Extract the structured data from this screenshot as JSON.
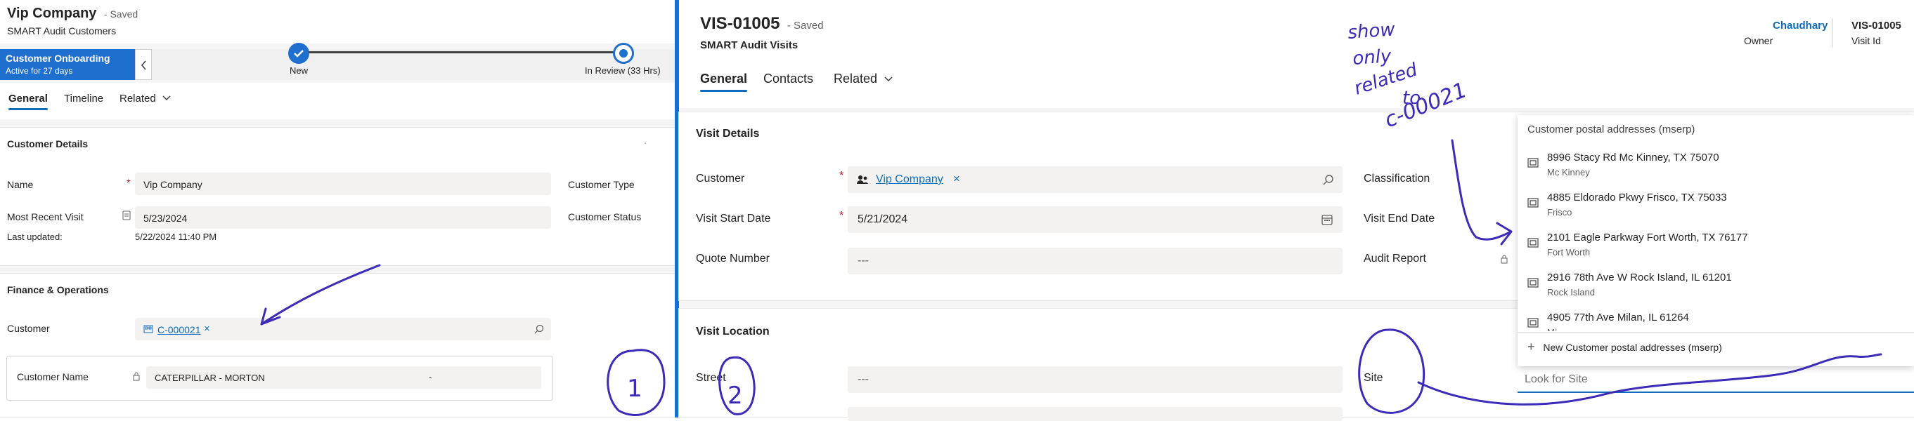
{
  "left": {
    "title": "Vip Company",
    "saved": "- Saved",
    "subtitle": "SMART Audit Customers",
    "bpf": {
      "stage_name": "Customer Onboarding",
      "stage_sub": "Active for 27 days",
      "step1": "New",
      "step2": "In Review",
      "step2_time": "(33 Hrs)"
    },
    "tabs": [
      "General",
      "Timeline",
      "Related"
    ],
    "customer_details": {
      "header": "Customer Details",
      "name_label": "Name",
      "name_value": "Vip Company",
      "customer_type_label": "Customer Type",
      "most_recent_visit_label": "Most Recent Visit",
      "most_recent_visit_value": "5/23/2024",
      "customer_status_label": "Customer Status",
      "last_updated_label": "Last updated:",
      "last_updated_value": "5/22/2024 11:40 PM"
    },
    "finance": {
      "header": "Finance & Operations",
      "customer_label": "Customer",
      "customer_value": "C-000021",
      "customer_name_label": "Customer Name",
      "customer_name_value": "CATERPILLAR - MORTON",
      "customer_name_suffix": "-"
    }
  },
  "right": {
    "title": "VIS-01005",
    "saved": "- Saved",
    "subtitle": "SMART Audit Visits",
    "owner_name": "Chaudhary",
    "owner_label": "Owner",
    "visit_id_value": "VIS-01005",
    "visit_id_label": "Visit Id",
    "tabs": [
      "General",
      "Contacts",
      "Related"
    ],
    "visit_details": {
      "header": "Visit Details",
      "customer_label": "Customer",
      "customer_value": "Vip Company",
      "classification_label": "Classification",
      "visit_start_label": "Visit Start Date",
      "visit_start_value": "5/21/2024",
      "visit_end_label": "Visit End Date",
      "quote_number_label": "Quote Number",
      "quote_number_value": "---",
      "audit_report_label": "Audit Report"
    },
    "visit_location": {
      "header": "Visit Location",
      "street_label": "Street",
      "street_value": "---",
      "site_label": "Site",
      "site_placeholder": "Look for Site"
    },
    "dropdown": {
      "header": "Customer postal addresses (mserp)",
      "items": [
        {
          "address": "8996 Stacy Rd Mc Kinney, TX 75070",
          "city": "Mc Kinney"
        },
        {
          "address": "4885 Eldorado Pkwy Frisco, TX 75033",
          "city": "Frisco"
        },
        {
          "address": "2101 Eagle Parkway Fort Worth, TX 76177",
          "city": "Fort Worth"
        },
        {
          "address": "2916 78th Ave W Rock Island, IL 61201",
          "city": "Rock Island"
        },
        {
          "address": "4905 77th Ave Milan, IL 61264",
          "city": "Mi"
        }
      ],
      "new_label": "New Customer postal addresses (mserp)"
    }
  },
  "annotations": {
    "note_lines": [
      "show",
      "only",
      "related",
      "to",
      "c-00021"
    ],
    "circle_1": "1",
    "circle_2": "2"
  },
  "colors": {
    "accent": "#0f6cbd",
    "bpf_stage": "#1f6fce",
    "ink": "#3b2bb8",
    "divider": "#1470d6"
  }
}
